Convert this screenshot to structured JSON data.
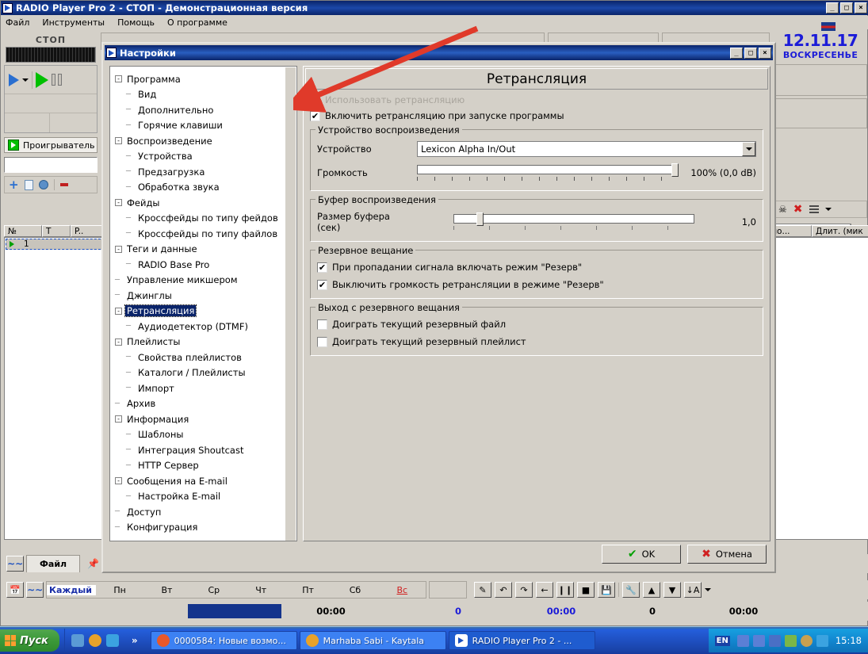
{
  "app": {
    "title": "RADIO Player Pro 2 - СТОП - Демонстрационная версия",
    "title_icon": "play-triangle-icon",
    "menu": [
      "Файл",
      "Инструменты",
      "Помощь",
      "О программе"
    ],
    "window_buttons": {
      "minimize": "_",
      "maximize": "□",
      "close": "×"
    },
    "player": {
      "state_label": "СТОП",
      "playlist_tab_label": "Проигрыватель"
    },
    "grid_columns_left": [
      "№",
      "T",
      "P.."
    ],
    "grid_columns_right": [
      "ьно...",
      "Длит. (мик"
    ],
    "first_row_number": "1",
    "date": {
      "value": "12.11.17",
      "day_of_week": "ВОСКРЕСЕНЬЕ"
    },
    "bottom": {
      "file_tab": "Файл",
      "days": [
        "Каждый",
        "Пн",
        "Вт",
        "Ср",
        "Чт",
        "Пт",
        "Сб",
        "Вс"
      ],
      "progress_time": "00:00",
      "status_values": [
        "0",
        "00:00",
        "0",
        "00:00"
      ]
    }
  },
  "dialog": {
    "title": "Настройки",
    "title_icon": "play-triangle-icon",
    "window_buttons": {
      "minimize": "_",
      "maximize": "□",
      "close": "×"
    },
    "tree": [
      {
        "label": "Программа",
        "level": 0,
        "toggle": "-"
      },
      {
        "label": "Вид",
        "level": 1
      },
      {
        "label": "Дополнительно",
        "level": 1
      },
      {
        "label": "Горячие клавиши",
        "level": 1
      },
      {
        "label": "Воспроизведение",
        "level": 0,
        "toggle": "-"
      },
      {
        "label": "Устройства",
        "level": 1
      },
      {
        "label": "Предзагрузка",
        "level": 1
      },
      {
        "label": "Обработка звука",
        "level": 1
      },
      {
        "label": "Фейды",
        "level": 0,
        "toggle": "-"
      },
      {
        "label": "Кроссфейды по типу фейдов",
        "level": 1
      },
      {
        "label": "Кроссфейды по типу файлов",
        "level": 1
      },
      {
        "label": "Теги и данные",
        "level": 0,
        "toggle": "-"
      },
      {
        "label": "RADIO Base Pro",
        "level": 1
      },
      {
        "label": "Управление микшером",
        "level": 0
      },
      {
        "label": "Джинглы",
        "level": 0
      },
      {
        "label": "Ретрансляция",
        "level": 0,
        "toggle": "-",
        "selected": true
      },
      {
        "label": "Аудиодетектор (DTMF)",
        "level": 1
      },
      {
        "label": "Плейлисты",
        "level": 0,
        "toggle": "-"
      },
      {
        "label": "Свойства плейлистов",
        "level": 1
      },
      {
        "label": "Каталоги / Плейлисты",
        "level": 1
      },
      {
        "label": "Импорт",
        "level": 1
      },
      {
        "label": "Архив",
        "level": 0
      },
      {
        "label": "Информация",
        "level": 0,
        "toggle": "-"
      },
      {
        "label": "Шаблоны",
        "level": 1
      },
      {
        "label": "Интеграция Shoutcast",
        "level": 1
      },
      {
        "label": "HTTP Сервер",
        "level": 1
      },
      {
        "label": "Сообщения на E-mail",
        "level": 0,
        "toggle": "-"
      },
      {
        "label": "Настройка E-mail",
        "level": 1
      },
      {
        "label": "Доступ",
        "level": 0
      },
      {
        "label": "Конфигурация",
        "level": 0
      }
    ],
    "panel": {
      "heading": "Ретрансляция",
      "checkbox_use_relay": {
        "label": "Использовать ретрансляцию",
        "checked": false,
        "disabled": true
      },
      "checkbox_start_relay": {
        "label": "Включить ретрансляцию при запуске программы",
        "checked": true
      },
      "group_playback_device": {
        "caption": "Устройство воспроизведения",
        "device_label": "Устройство",
        "device_value": "Lexicon Alpha In/Out",
        "volume_label": "Громкость",
        "volume_value": "100% (0,0 dB)",
        "volume_percent": 100
      },
      "group_buffer": {
        "caption": "Буфер воспроизведения",
        "size_label": "Размер буфера (сек)",
        "size_value": "1,0",
        "size_percent": 11
      },
      "group_reserve": {
        "caption": "Резервное вещание",
        "items": [
          {
            "label": "При пропадании сигнала включать режим \"Резерв\"",
            "checked": true
          },
          {
            "label": "Выключить громкость ретрансляции в режиме \"Резерв\"",
            "checked": true
          }
        ]
      },
      "group_exit_reserve": {
        "caption": "Выход с резервного вещания",
        "items": [
          {
            "label": "Доиграть текущий резервный файл",
            "checked": false
          },
          {
            "label": "Доиграть текущий резервный плейлист",
            "checked": false
          }
        ]
      }
    },
    "buttons": {
      "ok": "OK",
      "cancel": "Отмена"
    }
  },
  "taskbar": {
    "start": "Пуск",
    "overflow": "»",
    "tasks": [
      {
        "label": "0000584: Новые возмо...",
        "active": false
      },
      {
        "label": "Marhaba Sabi - Kaytala",
        "active": false
      },
      {
        "label": "RADIO Player Pro 2 - ...",
        "active": true
      }
    ],
    "language": "EN",
    "clock": "15:18"
  },
  "colors": {
    "title_blue": "#0a246a",
    "accent_blue": "#1b1bd8",
    "face": "#d4d0c8",
    "selection": "#0a246a",
    "arrow_red": "#e03a2a",
    "ok_green": "#00a000",
    "cancel_red": "#d02020"
  }
}
